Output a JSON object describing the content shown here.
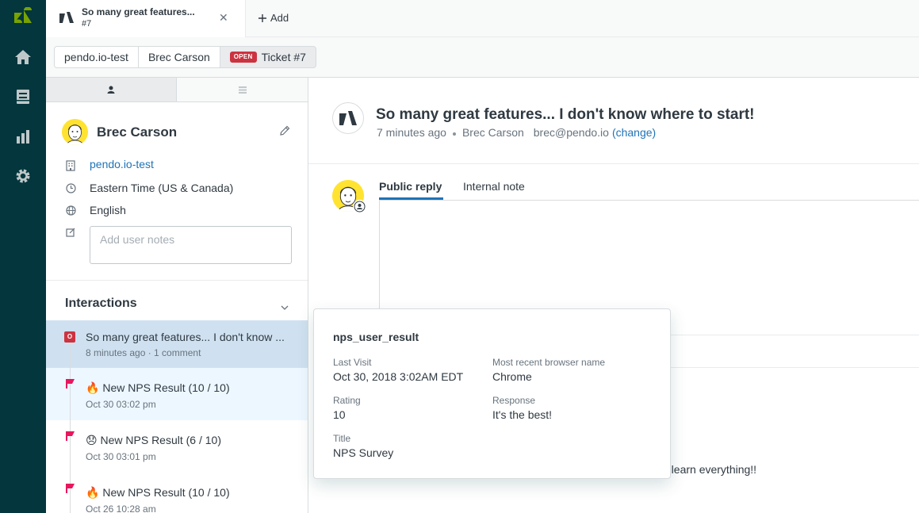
{
  "rail": {
    "icons": [
      "zendesk-logo-icon",
      "home-icon",
      "views-icon",
      "reporting-icon",
      "admin-gear-icon"
    ],
    "colors": {
      "background": "#03363d",
      "logo": "#78a300"
    }
  },
  "tabs": [
    {
      "title": "So many great features...",
      "subtitle": "#7",
      "close": "✕"
    }
  ],
  "add_tab_label": "Add",
  "breadcrumb": {
    "org": "pendo.io-test",
    "user": "Brec Carson",
    "status_badge": "OPEN",
    "ticket": "Ticket #7"
  },
  "user_panel": {
    "name": "Brec Carson",
    "organization": "pendo.io-test",
    "timezone": "Eastern Time (US & Canada)",
    "language": "English",
    "notes_placeholder": "Add user notes"
  },
  "interactions": {
    "title": "Interactions",
    "items": [
      {
        "badge": "O",
        "title": "So many great features... I don't know ...",
        "subtitle": "8 minutes ago · 1 comment"
      },
      {
        "emoji": "🔥",
        "title": "New NPS Result (10 / 10)",
        "subtitle": "Oct 30 03:02 pm"
      },
      {
        "emoji": "😞",
        "title": "New NPS Result (6 / 10)",
        "subtitle": "Oct 30 03:01 pm"
      },
      {
        "emoji": "🔥",
        "title": "New NPS Result (10 / 10)",
        "subtitle": "Oct 26 10:28 am"
      }
    ]
  },
  "ticket": {
    "title": "So many great features... I don't know where to start!",
    "time": "7 minutes ago",
    "requester": "Brec Carson",
    "email": "brec@pendo.io",
    "change_link": "(change)"
  },
  "reply": {
    "tabs": [
      "Public reply",
      "Internal note"
    ]
  },
  "comment_snippet": "e learn everything!!",
  "popover": {
    "title": "nps_user_result",
    "fields": [
      {
        "label": "Last Visit",
        "value": "Oct 30, 2018 3:02AM EDT"
      },
      {
        "label": "Most recent browser name",
        "value": "Chrome"
      },
      {
        "label": "Rating",
        "value": "10"
      },
      {
        "label": "Response",
        "value": "It's the best!"
      },
      {
        "label": "Title",
        "value": "NPS Survey"
      }
    ]
  }
}
